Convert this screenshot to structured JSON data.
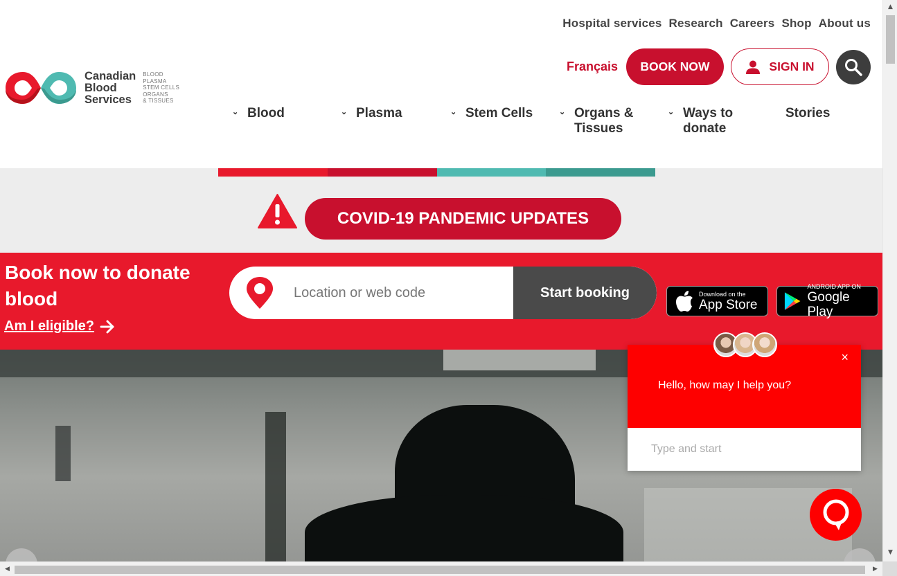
{
  "utility_nav": [
    "Hospital services",
    "Research",
    "Careers",
    "Shop",
    "About us"
  ],
  "logo": {
    "name_lines": [
      "Canadian",
      "Blood",
      "Services"
    ],
    "tag_lines": [
      "BLOOD",
      "PLASMA",
      "STEM CELLS",
      "ORGANS",
      "& TISSUES"
    ]
  },
  "actions": {
    "language": "Français",
    "book_now": "BOOK NOW",
    "sign_in": "SIGN IN"
  },
  "main_nav": [
    {
      "line1": "Blood",
      "line2": ""
    },
    {
      "line1": "Plasma",
      "line2": ""
    },
    {
      "line1": "Stem Cells",
      "line2": ""
    },
    {
      "line1": "Organs &",
      "line2": "Tissues"
    },
    {
      "line1": "Ways to",
      "line2": "donate"
    },
    {
      "line1": "Stories",
      "line2": ""
    }
  ],
  "covid": {
    "button": "COVID-19 PANDEMIC UPDATES"
  },
  "booking": {
    "heading": "Book now to donate blood",
    "eligible_link": "Am I eligible?",
    "search_placeholder": "Location or web code",
    "start_button": "Start booking",
    "app_store": {
      "small": "Download on the",
      "big": "App Store"
    },
    "google_play": {
      "small": "ANDROID APP ON",
      "big": "Google Play"
    }
  },
  "chat": {
    "message": "Hello, how may I help you?",
    "close": "×",
    "input_placeholder": "Type and start"
  },
  "colors": {
    "brand_red": "#c8102e",
    "band_red": "#e8192c",
    "teal": "#4fbab1",
    "dark_teal": "#3b9a8f"
  }
}
